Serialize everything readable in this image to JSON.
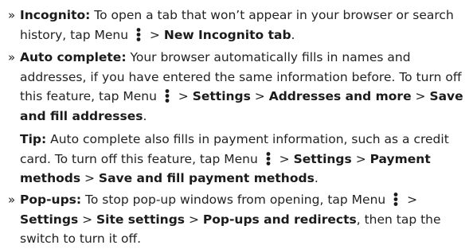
{
  "items": [
    {
      "bullet": "»",
      "label": "Incognito:",
      "text1": " To open a tab that won’t appear in your browser or search history, tap Menu ",
      "text2": " > ",
      "step1": "New Incognito tab",
      "end": "."
    },
    {
      "bullet": "»",
      "label": "Auto complete:",
      "text1": " Your browser automatically fills in names and addresses, if you have entered the same information before. To turn off this feature, tap Menu ",
      "sep1": " > ",
      "step1": "Settings",
      "sep2": " > ",
      "step2": "Addresses and more",
      "sep3": " > ",
      "step3": "Save and fill addresses",
      "end": "."
    },
    {
      "label": "Tip:",
      "text1": " Auto complete also fills in payment information, such as a credit card. To turn off this feature, tap Menu ",
      "sep1": " > ",
      "step1": "Settings",
      "sep2": " > ",
      "step2": "Payment methods",
      "sep3": " > ",
      "step3": "Save and fill payment methods",
      "end": "."
    },
    {
      "bullet": "»",
      "label": "Pop-ups:",
      "text1": " To stop pop-up windows from opening, tap Menu ",
      "sep1": " > ",
      "step1": "Settings",
      "sep2": " > ",
      "step2": "Site settings",
      "sep3": " > ",
      "step3": "Pop-ups and redirects",
      "text2": ", then tap the switch to turn it off."
    }
  ],
  "icons": {
    "menu": "more-vert-icon"
  }
}
